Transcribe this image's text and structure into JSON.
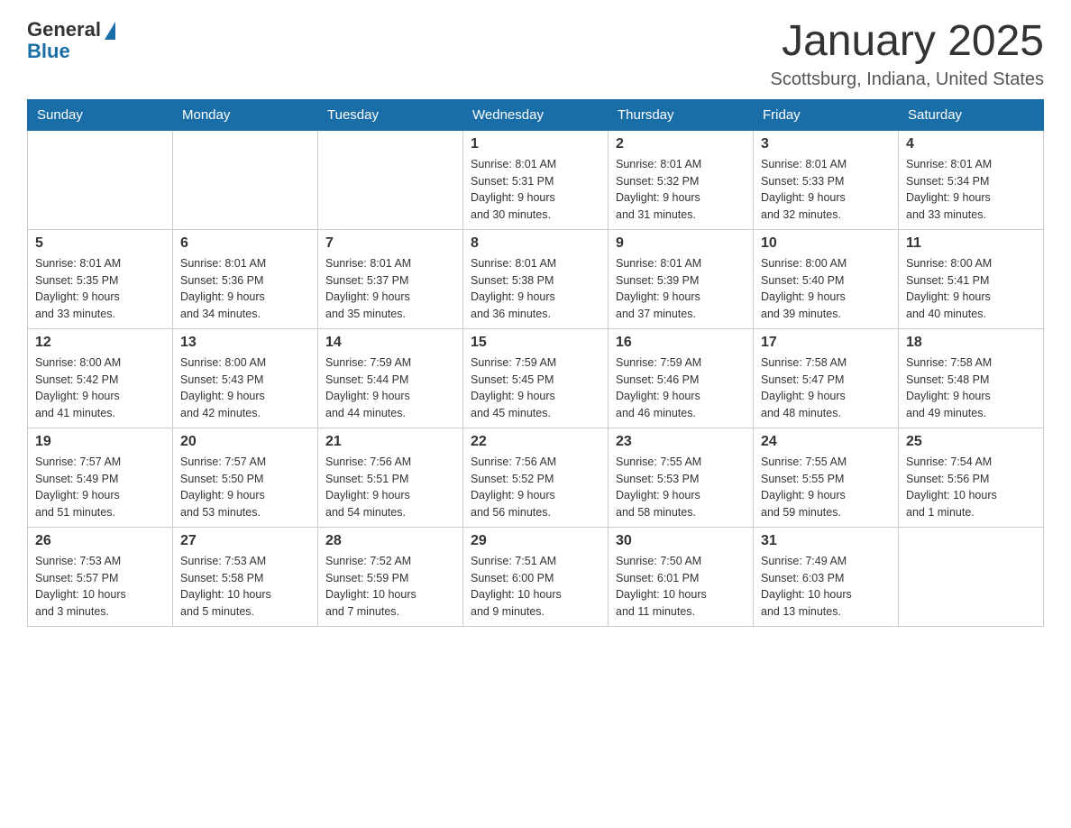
{
  "logo": {
    "general": "General",
    "blue": "Blue"
  },
  "title": "January 2025",
  "location": "Scottsburg, Indiana, United States",
  "weekdays": [
    "Sunday",
    "Monday",
    "Tuesday",
    "Wednesday",
    "Thursday",
    "Friday",
    "Saturday"
  ],
  "weeks": [
    [
      {
        "day": "",
        "info": ""
      },
      {
        "day": "",
        "info": ""
      },
      {
        "day": "",
        "info": ""
      },
      {
        "day": "1",
        "info": "Sunrise: 8:01 AM\nSunset: 5:31 PM\nDaylight: 9 hours\nand 30 minutes."
      },
      {
        "day": "2",
        "info": "Sunrise: 8:01 AM\nSunset: 5:32 PM\nDaylight: 9 hours\nand 31 minutes."
      },
      {
        "day": "3",
        "info": "Sunrise: 8:01 AM\nSunset: 5:33 PM\nDaylight: 9 hours\nand 32 minutes."
      },
      {
        "day": "4",
        "info": "Sunrise: 8:01 AM\nSunset: 5:34 PM\nDaylight: 9 hours\nand 33 minutes."
      }
    ],
    [
      {
        "day": "5",
        "info": "Sunrise: 8:01 AM\nSunset: 5:35 PM\nDaylight: 9 hours\nand 33 minutes."
      },
      {
        "day": "6",
        "info": "Sunrise: 8:01 AM\nSunset: 5:36 PM\nDaylight: 9 hours\nand 34 minutes."
      },
      {
        "day": "7",
        "info": "Sunrise: 8:01 AM\nSunset: 5:37 PM\nDaylight: 9 hours\nand 35 minutes."
      },
      {
        "day": "8",
        "info": "Sunrise: 8:01 AM\nSunset: 5:38 PM\nDaylight: 9 hours\nand 36 minutes."
      },
      {
        "day": "9",
        "info": "Sunrise: 8:01 AM\nSunset: 5:39 PM\nDaylight: 9 hours\nand 37 minutes."
      },
      {
        "day": "10",
        "info": "Sunrise: 8:00 AM\nSunset: 5:40 PM\nDaylight: 9 hours\nand 39 minutes."
      },
      {
        "day": "11",
        "info": "Sunrise: 8:00 AM\nSunset: 5:41 PM\nDaylight: 9 hours\nand 40 minutes."
      }
    ],
    [
      {
        "day": "12",
        "info": "Sunrise: 8:00 AM\nSunset: 5:42 PM\nDaylight: 9 hours\nand 41 minutes."
      },
      {
        "day": "13",
        "info": "Sunrise: 8:00 AM\nSunset: 5:43 PM\nDaylight: 9 hours\nand 42 minutes."
      },
      {
        "day": "14",
        "info": "Sunrise: 7:59 AM\nSunset: 5:44 PM\nDaylight: 9 hours\nand 44 minutes."
      },
      {
        "day": "15",
        "info": "Sunrise: 7:59 AM\nSunset: 5:45 PM\nDaylight: 9 hours\nand 45 minutes."
      },
      {
        "day": "16",
        "info": "Sunrise: 7:59 AM\nSunset: 5:46 PM\nDaylight: 9 hours\nand 46 minutes."
      },
      {
        "day": "17",
        "info": "Sunrise: 7:58 AM\nSunset: 5:47 PM\nDaylight: 9 hours\nand 48 minutes."
      },
      {
        "day": "18",
        "info": "Sunrise: 7:58 AM\nSunset: 5:48 PM\nDaylight: 9 hours\nand 49 minutes."
      }
    ],
    [
      {
        "day": "19",
        "info": "Sunrise: 7:57 AM\nSunset: 5:49 PM\nDaylight: 9 hours\nand 51 minutes."
      },
      {
        "day": "20",
        "info": "Sunrise: 7:57 AM\nSunset: 5:50 PM\nDaylight: 9 hours\nand 53 minutes."
      },
      {
        "day": "21",
        "info": "Sunrise: 7:56 AM\nSunset: 5:51 PM\nDaylight: 9 hours\nand 54 minutes."
      },
      {
        "day": "22",
        "info": "Sunrise: 7:56 AM\nSunset: 5:52 PM\nDaylight: 9 hours\nand 56 minutes."
      },
      {
        "day": "23",
        "info": "Sunrise: 7:55 AM\nSunset: 5:53 PM\nDaylight: 9 hours\nand 58 minutes."
      },
      {
        "day": "24",
        "info": "Sunrise: 7:55 AM\nSunset: 5:55 PM\nDaylight: 9 hours\nand 59 minutes."
      },
      {
        "day": "25",
        "info": "Sunrise: 7:54 AM\nSunset: 5:56 PM\nDaylight: 10 hours\nand 1 minute."
      }
    ],
    [
      {
        "day": "26",
        "info": "Sunrise: 7:53 AM\nSunset: 5:57 PM\nDaylight: 10 hours\nand 3 minutes."
      },
      {
        "day": "27",
        "info": "Sunrise: 7:53 AM\nSunset: 5:58 PM\nDaylight: 10 hours\nand 5 minutes."
      },
      {
        "day": "28",
        "info": "Sunrise: 7:52 AM\nSunset: 5:59 PM\nDaylight: 10 hours\nand 7 minutes."
      },
      {
        "day": "29",
        "info": "Sunrise: 7:51 AM\nSunset: 6:00 PM\nDaylight: 10 hours\nand 9 minutes."
      },
      {
        "day": "30",
        "info": "Sunrise: 7:50 AM\nSunset: 6:01 PM\nDaylight: 10 hours\nand 11 minutes."
      },
      {
        "day": "31",
        "info": "Sunrise: 7:49 AM\nSunset: 6:03 PM\nDaylight: 10 hours\nand 13 minutes."
      },
      {
        "day": "",
        "info": ""
      }
    ]
  ]
}
